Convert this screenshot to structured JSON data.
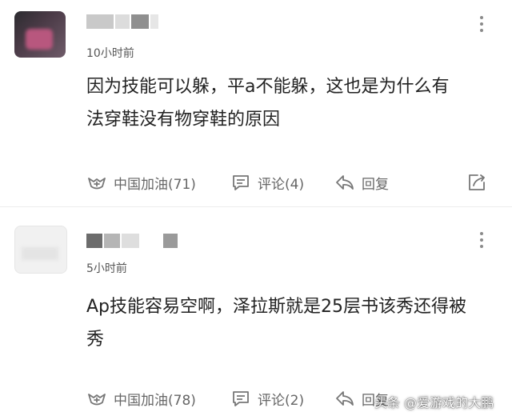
{
  "comments": [
    {
      "time": "10小时前",
      "text_lines": [
        "因为技能可以躲，平a不能躲，这也是为什么有",
        "法穿鞋没有物穿鞋的原因"
      ],
      "actions": {
        "like": "中国加油(71)",
        "comment": "评论(4)",
        "reply": "回复"
      }
    },
    {
      "time": "5小时前",
      "text_lines": [
        "Ap技能容易空啊，泽拉斯就是25层书该秀还得被",
        "秀"
      ],
      "actions": {
        "like": "中国加油(78)",
        "comment": "评论(2)",
        "reply": "回复"
      }
    }
  ],
  "watermark": "头条 @爱游戏的大鹏",
  "icons": {
    "like": "heart-cheer-icon",
    "comment": "speech-bubble-icon",
    "reply": "reply-arrow-icon",
    "share": "share-icon",
    "more": "more-vertical-icon"
  },
  "colors": {
    "text": "#222222",
    "meta": "#666666",
    "divider": "#ececec"
  }
}
